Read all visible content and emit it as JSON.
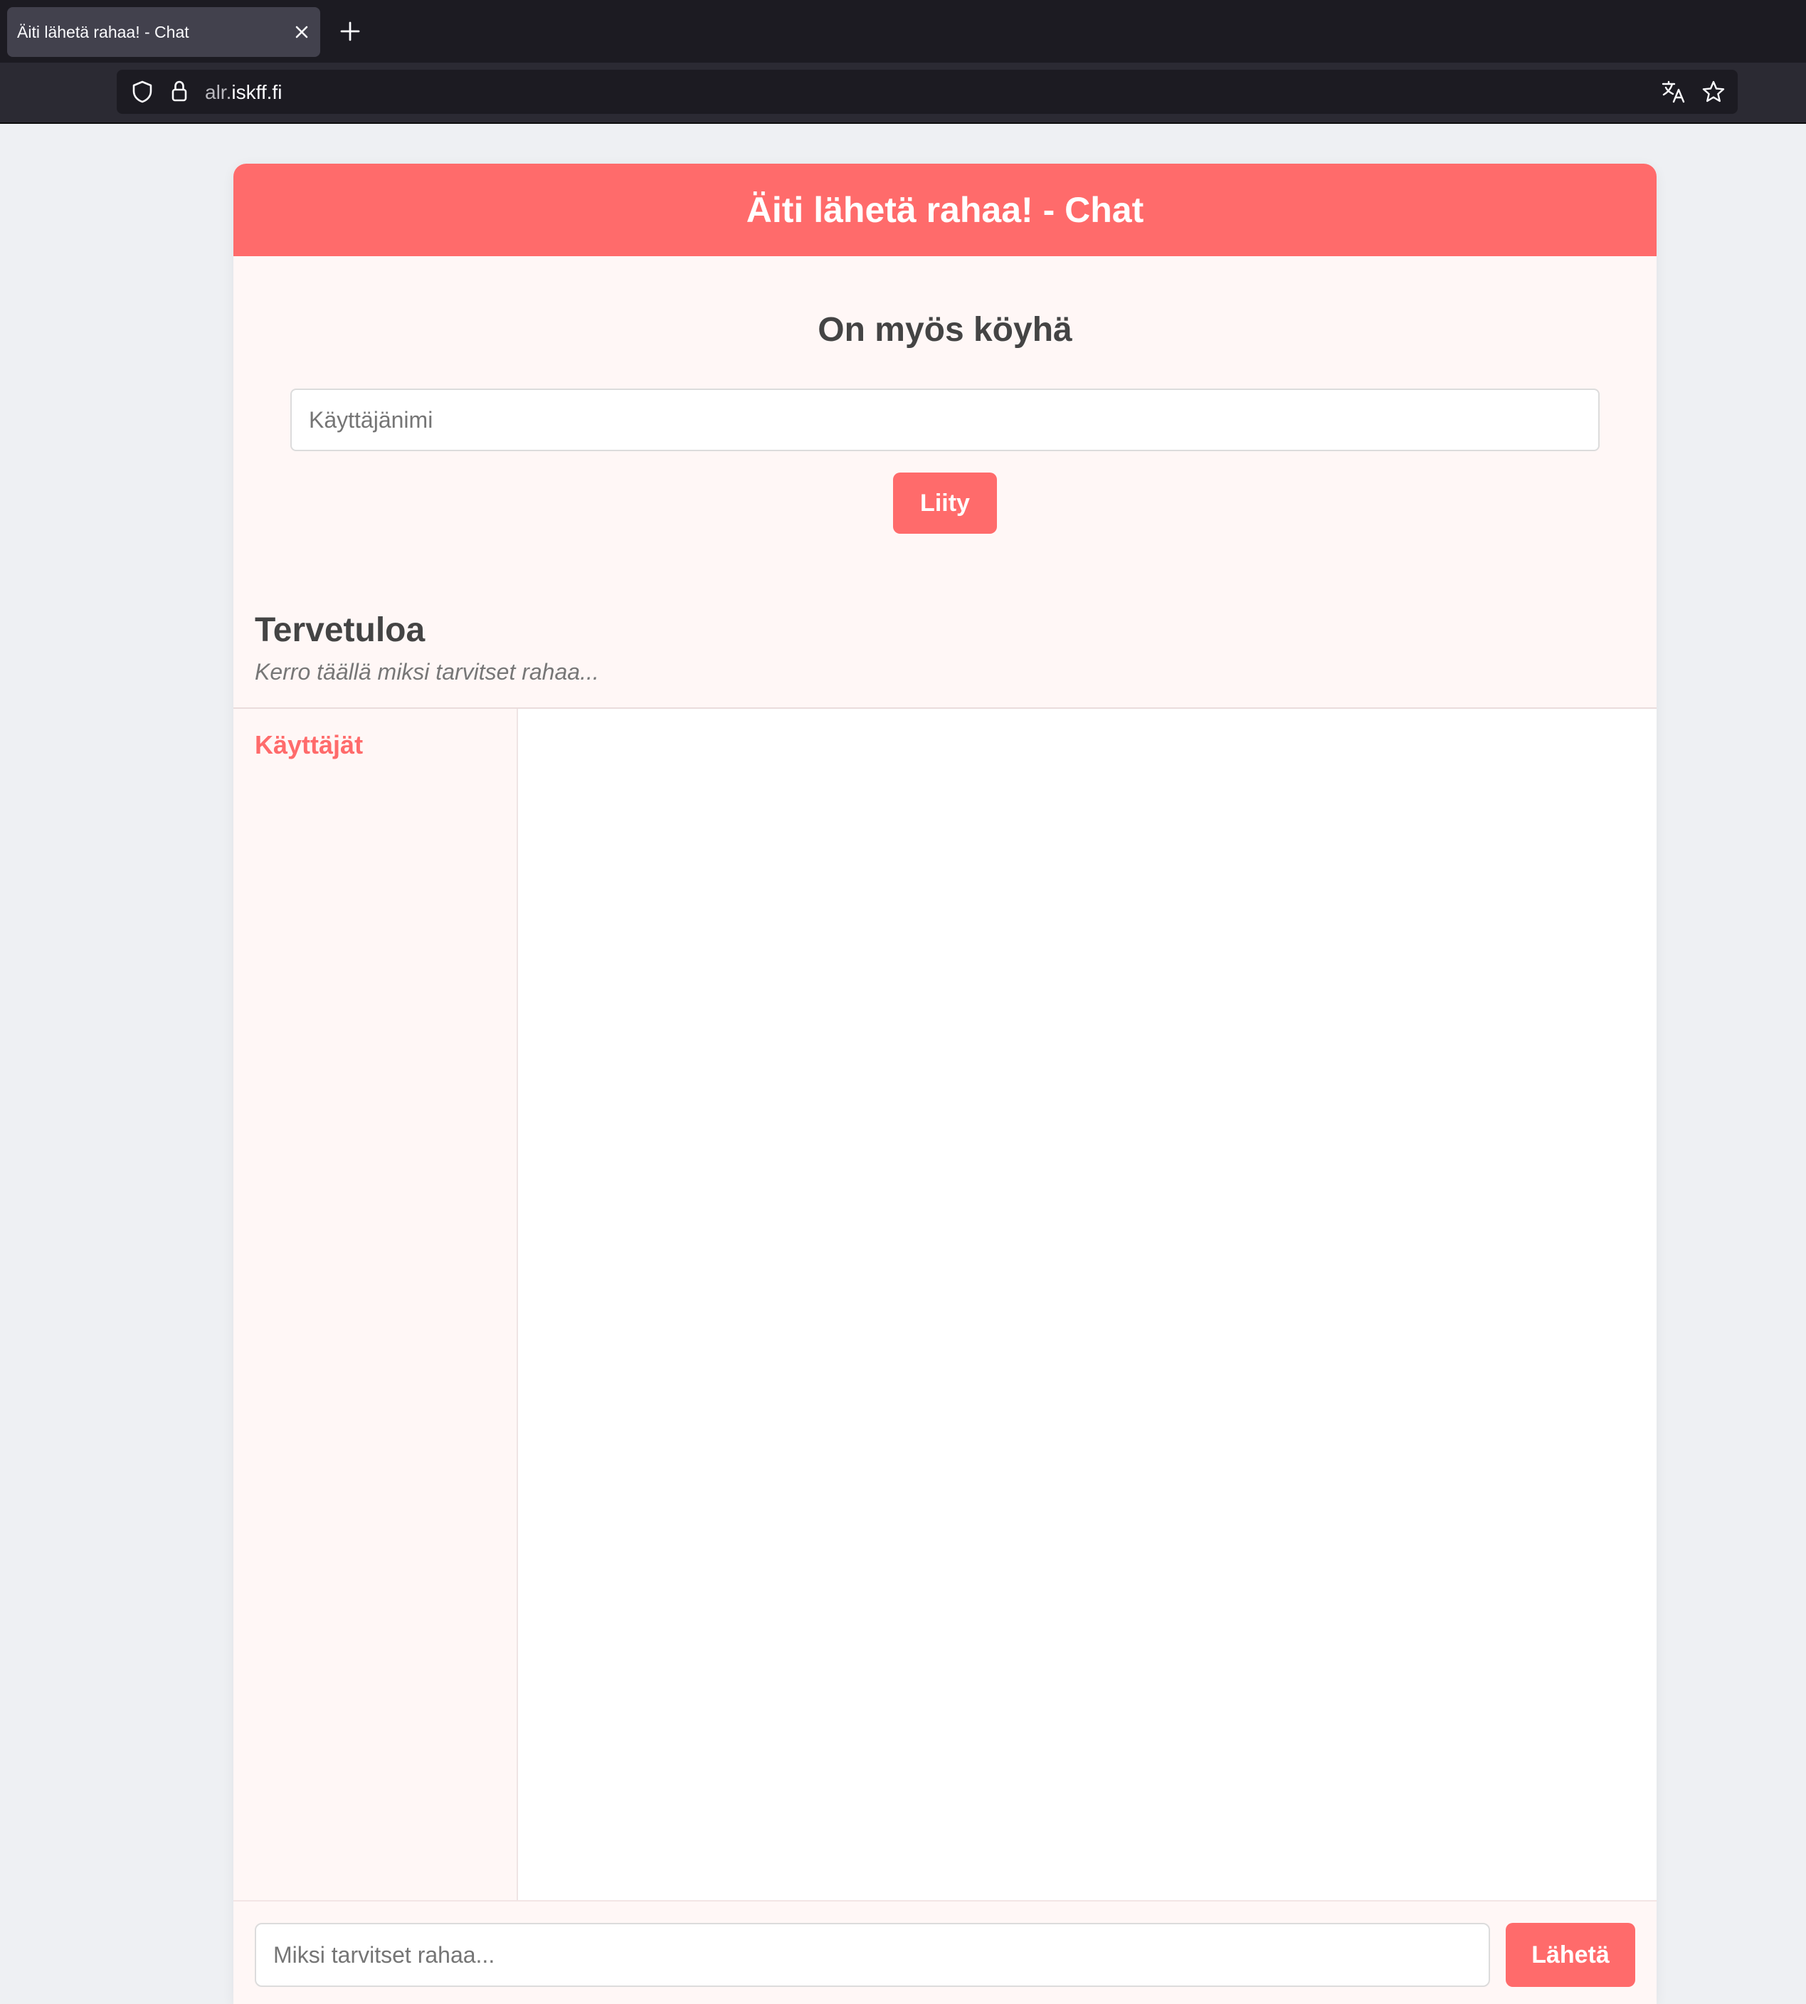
{
  "browser": {
    "tab_title": "Äiti lähetä rahaa! - Chat",
    "url_subdomain": "alr.",
    "url_domain": "iskff.fi",
    "icons": [
      "close-icon",
      "plus-icon",
      "shield-icon",
      "lock-icon",
      "translate-icon",
      "star-icon"
    ]
  },
  "app": {
    "header_title": "Äiti lähetä rahaa! - Chat",
    "subtitle": "On myös köyhä",
    "username_placeholder": "Käyttäjänimi",
    "join_label": "Liity",
    "welcome_title": "Tervetuloa",
    "welcome_text": "Kerro täällä miksi tarvitset rahaa...",
    "users_title": "Käyttäjät",
    "message_placeholder": "Miksi tarvitset rahaa...",
    "send_label": "Lähetä"
  },
  "colors": {
    "accent": "#ff6b6b",
    "card_background": "#fff7f6",
    "page_background": "#eef0f3",
    "heading_text": "#444444"
  }
}
